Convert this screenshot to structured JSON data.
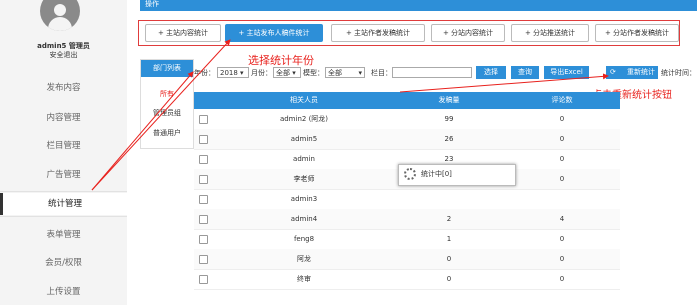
{
  "user": {
    "name": "admin5 管理员",
    "logout": "安全退出"
  },
  "sidebar": {
    "items": [
      {
        "label": "发布内容"
      },
      {
        "label": "内容管理"
      },
      {
        "label": "栏目管理"
      },
      {
        "label": "广告管理"
      },
      {
        "label": "统计管理"
      },
      {
        "label": "表单管理"
      },
      {
        "label": "会员/权限"
      },
      {
        "label": "上传设置"
      }
    ],
    "active_index": 4
  },
  "topbar": {
    "title": "操作"
  },
  "tabs": [
    {
      "label": "+  主站内容统计"
    },
    {
      "label": "+  主站发布人稿件统计"
    },
    {
      "label": "+  主站作者发稿统计"
    },
    {
      "label": "+  分站内容统计"
    },
    {
      "label": "+  分站推送统计"
    },
    {
      "label": "+  分站作者发稿统计"
    }
  ],
  "annotations": {
    "year": "选择统计年份",
    "recount": "点击重新统计按钮"
  },
  "dept": {
    "title": "部门列表",
    "items": [
      "所有",
      "管理员组",
      "普通用户"
    ]
  },
  "filter": {
    "year_label": "年份：",
    "year_value": "2018 ▾",
    "month_label": "月份：",
    "month_value": "全部 ▾",
    "model_label": "模型：",
    "model_value": "全部",
    "model_arrow": "▾",
    "column_label": "栏目：",
    "select_btn": "选择",
    "query_btn": "查询",
    "export_btn": "导出Excel",
    "recount_btn": "重新统计",
    "time_label": "统计时间："
  },
  "table": {
    "headers": [
      "相关人员",
      "发稿量",
      "评论数"
    ],
    "rows": [
      [
        "admin2 (阿龙)",
        "99",
        "0"
      ],
      [
        "admin5",
        "26",
        "0"
      ],
      [
        "admin",
        "23",
        "0"
      ],
      [
        "李老师",
        "3",
        "0"
      ],
      [
        "admin3",
        "",
        ""
      ],
      [
        "admin4",
        "2",
        "4"
      ],
      [
        "feng8",
        "1",
        "0"
      ],
      [
        "阿龙",
        "0",
        "0"
      ],
      [
        "终审",
        "0",
        "0"
      ]
    ]
  },
  "loading": {
    "text": "统计中[0]"
  },
  "colors": {
    "accent": "#2d8fd8",
    "annotation": "#e8211d"
  }
}
